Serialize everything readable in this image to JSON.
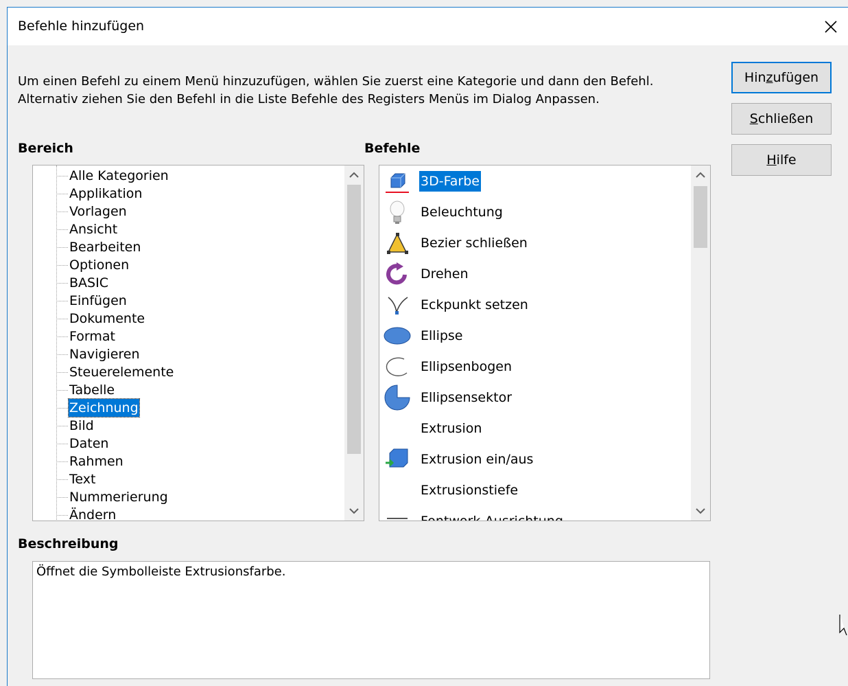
{
  "dialog": {
    "title": "Befehle hinzufügen",
    "intro_line1": "Um einen Befehl zu einem Menü hinzuzufügen, wählen Sie zuerst eine Kategorie und dann den Befehl.",
    "intro_line2": "Alternativ ziehen Sie den Befehl in die Liste Befehle des Registers Menüs im Dialog Anpassen."
  },
  "bereich": {
    "label": "Bereich",
    "items": [
      "Alle Kategorien",
      "Applikation",
      "Vorlagen",
      "Ansicht",
      "Bearbeiten",
      "Optionen",
      "BASIC",
      "Einfügen",
      "Dokumente",
      "Format",
      "Navigieren",
      "Steuerelemente",
      "Tabelle",
      "Zeichnung",
      "Bild",
      "Daten",
      "Rahmen",
      "Text",
      "Nummerierung",
      "Ändern"
    ],
    "selected": "Zeichnung"
  },
  "befehle": {
    "label": "Befehle",
    "items": [
      {
        "label": "3D-Farbe",
        "icon": "cube-icon"
      },
      {
        "label": "Beleuchtung",
        "icon": "lightbulb-icon"
      },
      {
        "label": "Bezier schließen",
        "icon": "bezier-close-icon"
      },
      {
        "label": "Drehen",
        "icon": "rotate-icon"
      },
      {
        "label": "Eckpunkt setzen",
        "icon": "corner-point-icon"
      },
      {
        "label": "Ellipse",
        "icon": "ellipse-icon"
      },
      {
        "label": "Ellipsenbogen",
        "icon": "ellipse-arc-icon"
      },
      {
        "label": "Ellipsensektor",
        "icon": "ellipse-sector-icon"
      },
      {
        "label": "Extrusion",
        "icon": ""
      },
      {
        "label": "Extrusion ein/aus",
        "icon": "extrusion-toggle-icon"
      },
      {
        "label": "Extrusionstiefe",
        "icon": ""
      },
      {
        "label": "Fontwork-Ausrichtung",
        "icon": "fontwork-align-icon"
      }
    ],
    "selected": "3D-Farbe"
  },
  "buttons": {
    "add": {
      "pre": "Hin",
      "accel": "z",
      "post": "ufügen"
    },
    "close": {
      "pre": "",
      "accel": "S",
      "post": "chließen"
    },
    "help": {
      "pre": "",
      "accel": "H",
      "post": "ilfe"
    }
  },
  "beschreibung": {
    "label": "Beschreibung",
    "text": "Öffnet die Symbolleiste Extrusionsfarbe."
  },
  "colors": {
    "selection": "#0078d7",
    "red_underline": "#e81123"
  }
}
